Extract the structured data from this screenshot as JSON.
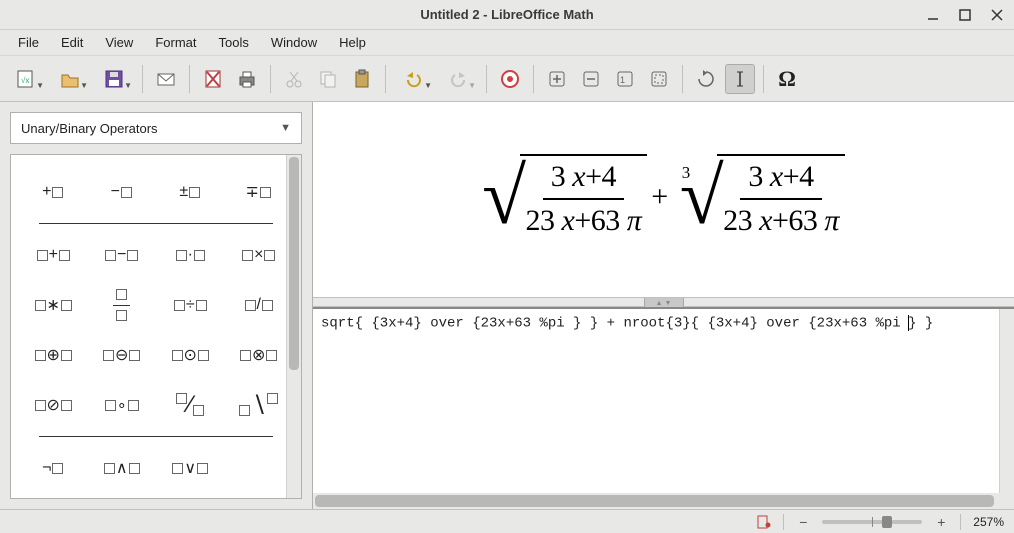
{
  "window": {
    "title": "Untitled 2 - LibreOffice Math"
  },
  "menu": {
    "file": "File",
    "edit": "Edit",
    "view": "View",
    "format": "Format",
    "tools": "Tools",
    "window": "Window",
    "help": "Help"
  },
  "sidebar": {
    "category": "Unary/Binary Operators"
  },
  "formula": {
    "sqrt_num": "3 x+4",
    "sqrt_den": "23 x+63 π",
    "plus": "+",
    "root_index": "3",
    "root_num": "3 x+4",
    "root_den": "23 x+63 π"
  },
  "editor": {
    "text_before_cursor": "sqrt{ {3x+4} over {23x+63 %pi } } + nroot{3}{ {3x+4} over {23x+63 %pi ",
    "text_after_cursor": "} }"
  },
  "status": {
    "zoom": "257%"
  }
}
